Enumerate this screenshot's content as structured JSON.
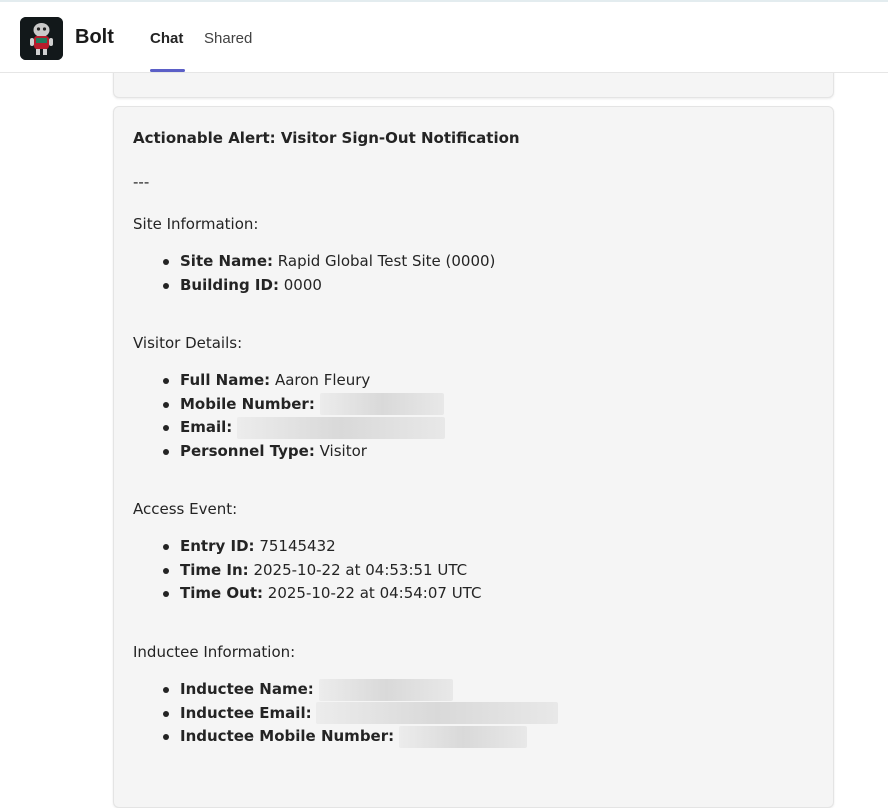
{
  "app": {
    "name": "Bolt"
  },
  "tabs": [
    {
      "label": "Chat",
      "active": true
    },
    {
      "label": "Shared",
      "active": false
    }
  ],
  "accent_color": "#5b5fc7",
  "message": {
    "title": "Actionable Alert: Visitor Sign-Out Notification",
    "separator": "---",
    "sections": {
      "site": {
        "heading": "Site Information:",
        "site_name_label": "Site Name:",
        "site_name_value": "Rapid Global Test Site (0000)",
        "building_id_label": "Building ID:",
        "building_id_value": "0000"
      },
      "visitor": {
        "heading": "Visitor Details:",
        "full_name_label": "Full Name:",
        "full_name_value": "Aaron Fleury",
        "mobile_label": "Mobile Number:",
        "email_label": "Email:",
        "personnel_type_label": "Personnel Type:",
        "personnel_type_value": "Visitor"
      },
      "access": {
        "heading": "Access Event:",
        "entry_id_label": "Entry ID:",
        "entry_id_value": "75145432",
        "time_in_label": "Time In:",
        "time_in_value": "2025-10-22 at 04:53:51 UTC",
        "time_out_label": "Time Out:",
        "time_out_value": "2025-10-22 at 04:54:07 UTC"
      },
      "inductee": {
        "heading": "Inductee Information:",
        "name_label": "Inductee Name:",
        "email_label": "Inductee Email:",
        "mobile_label": "Inductee Mobile Number:"
      }
    }
  }
}
